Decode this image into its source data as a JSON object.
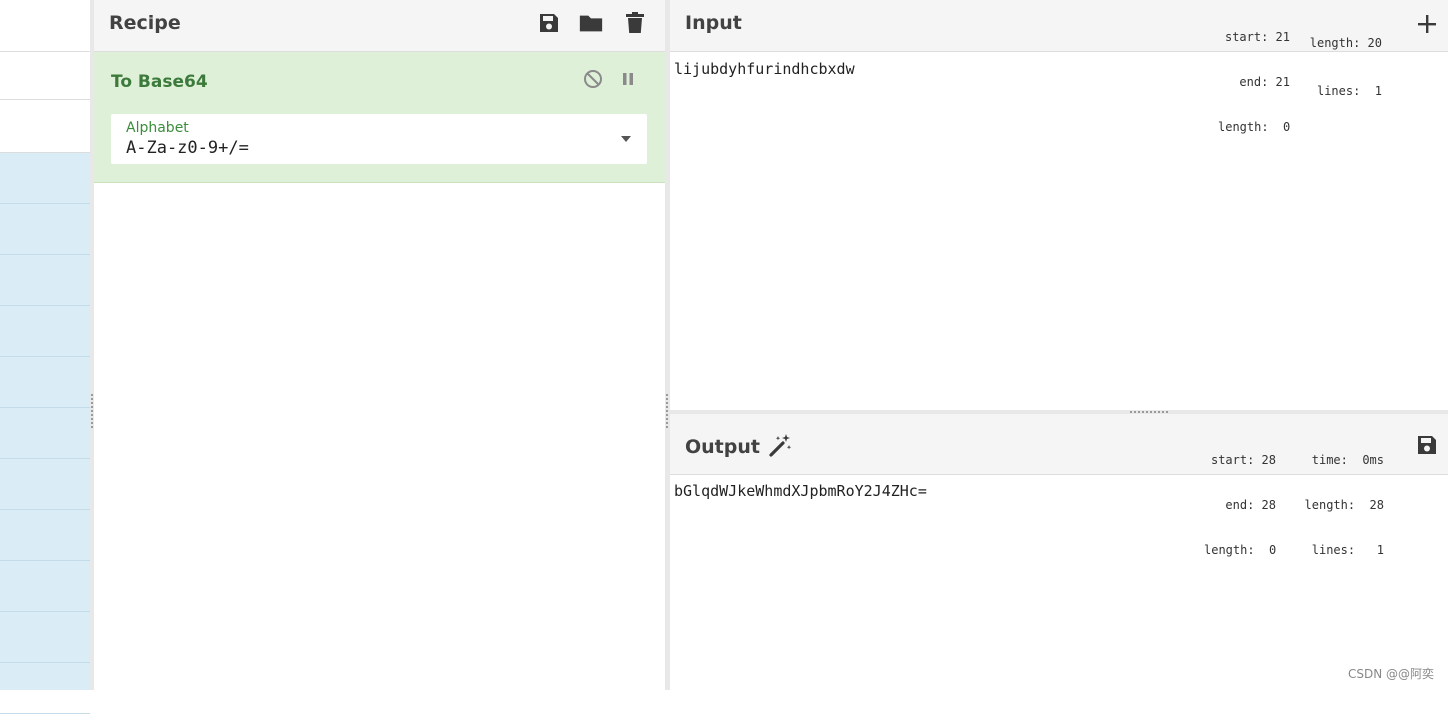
{
  "sidebar": {
    "star_icon": "star-icon",
    "star_color": "#1976d2",
    "list_count": 11
  },
  "recipe": {
    "title": "Recipe",
    "icons": [
      "save-icon",
      "folder-icon",
      "trash-icon"
    ],
    "operation": {
      "name": "To Base64",
      "alphabet_label": "Alphabet",
      "alphabet_value": "A-Za-z0-9+/=",
      "controls": [
        "disable-icon",
        "pause-icon"
      ]
    }
  },
  "input": {
    "title": "Input",
    "stats": {
      "start": "start: 21",
      "end": "end: 21",
      "length_sel": "length:  0",
      "length": "length: 20",
      "lines": "lines:  1"
    },
    "text": "lijubdyhfurindhcbxdw"
  },
  "output": {
    "title": "Output",
    "stats": {
      "start": "start: 28",
      "end": "end: 28",
      "length_sel": "length:  0",
      "time": "time:  0ms",
      "length": "length:  28",
      "lines": "lines:   1"
    },
    "text": "bGlqdWJkeWhmdXJpbmRoY2J4ZHc="
  },
  "watermark": "CSDN @@阿奕",
  "colors": {
    "accent_green": "#3c7a3c",
    "op_bg": "#dff0d8",
    "sidebar_blue": "#daedf7"
  }
}
